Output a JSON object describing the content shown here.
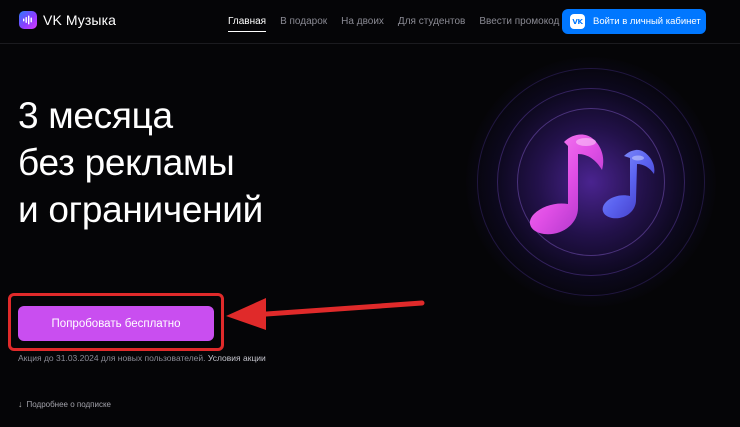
{
  "header": {
    "logo_text": "VK Музыка",
    "nav": [
      {
        "label": "Главная",
        "active": true
      },
      {
        "label": "В подарок",
        "active": false
      },
      {
        "label": "На двоих",
        "active": false
      },
      {
        "label": "Для студентов",
        "active": false
      },
      {
        "label": "Ввести промокод",
        "active": false
      }
    ],
    "login_button": {
      "icon_text": "VK",
      "label": "Войти в личный кабинет"
    }
  },
  "hero": {
    "title_lines": [
      "3 месяца",
      "без рекламы",
      "и ограничений"
    ]
  },
  "cta": {
    "label": "Попробовать бесплатно"
  },
  "promo": {
    "text": "Акция до 31.03.2024 для новых пользователей.",
    "link": "Условия акции"
  },
  "more": {
    "icon": "arrow-down-icon",
    "icon_glyph": "↓",
    "label": "Подробнее о подписке"
  },
  "colors": {
    "background": "#050507",
    "accent_blue": "#0077ff",
    "cta_purple": "#c94ef0",
    "annotation_red": "#e02a2a"
  },
  "icons": {
    "logo": "vk-music-logo-icon",
    "notes": "music-notes-icon",
    "annotation": "red-arrow-pointer-icon"
  }
}
